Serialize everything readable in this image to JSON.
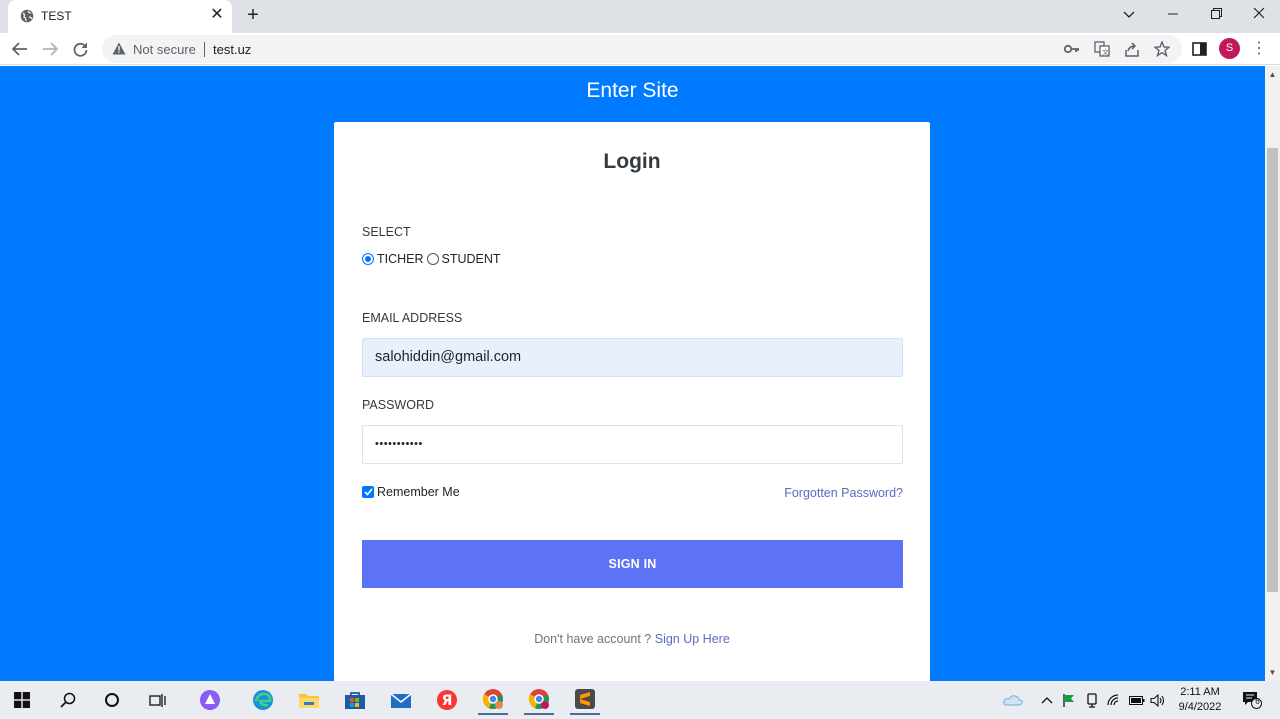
{
  "browser": {
    "tab_title": "TEST",
    "security_label": "Not secure",
    "url": "test.uz",
    "profile_initial": "S"
  },
  "page": {
    "site_title": "Enter Site",
    "login": {
      "title": "Login",
      "select_label": "SELECT",
      "role_options": [
        "TICHER",
        "STUDENT"
      ],
      "selected_role": "TICHER",
      "email_label": "EMAIL ADDRESS",
      "email_value": "salohiddin@gmail.com",
      "password_label": "PASSWORD",
      "password_value": "•••••••••••",
      "remember_label": "Remember Me",
      "remember_checked": true,
      "forgot_label": "Forgotten Password?",
      "signin_label": "SIGN IN",
      "no_account_text": "Don't have account ? ",
      "signup_label": "Sign Up Here"
    }
  },
  "taskbar": {
    "time": "2:11 AM",
    "date": "9/4/2022",
    "notification_count": "6"
  },
  "colors": {
    "page_background": "#007bff",
    "signin_button": "#5b73f4",
    "link": "#5c6bc0"
  }
}
